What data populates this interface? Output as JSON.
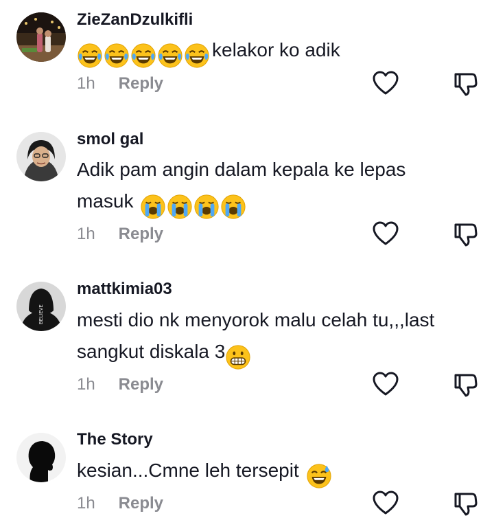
{
  "comments": [
    {
      "username": "ZieZanDzulkifli",
      "emojis": [
        "joy-emoji",
        "joy-emoji",
        "joy-emoji",
        "joy-emoji",
        "joy-emoji"
      ],
      "text_after": "kelakor ko adik",
      "time": "1h",
      "reply": "Reply"
    },
    {
      "username": "smol gal",
      "text_line1": "Adik pam angin dalam kepala ke lepas",
      "text_line2": "masuk",
      "emojis": [
        "loudly-crying-emoji",
        "loudly-crying-emoji",
        "loudly-crying-emoji",
        "loudly-crying-emoji"
      ],
      "time": "1h",
      "reply": "Reply"
    },
    {
      "username": "mattkimia03",
      "text_line1": "mesti dio nk menyorok malu celah tu,,,last",
      "text_line2": "sangkut diskala 3",
      "emojis": [
        "grimacing-emoji"
      ],
      "time": "1h",
      "reply": "Reply"
    },
    {
      "username": "The Story",
      "text": "kesian...Cmne leh tersepit",
      "emojis": [
        "sweat-smile-emoji"
      ],
      "time": "1h",
      "reply": "Reply"
    }
  ],
  "icons": {
    "like": "heart-outline-icon",
    "dislike": "thumbs-down-outline-icon"
  },
  "colors": {
    "text": "#161823",
    "meta": "#8a8b91",
    "emoji_face": "#fcc21b"
  }
}
